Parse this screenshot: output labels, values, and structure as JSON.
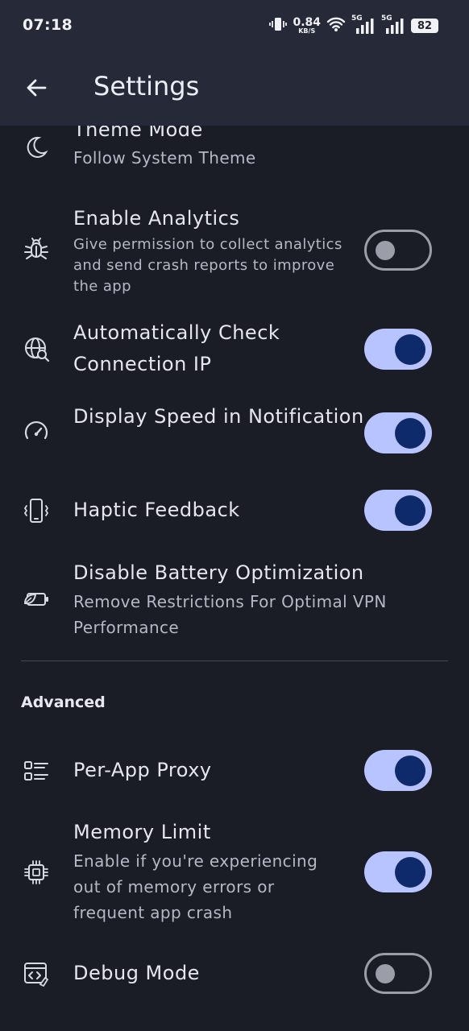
{
  "status_bar": {
    "time": "07:18",
    "net_speed_value": "0.84",
    "net_speed_unit": "KB/S",
    "net_type_1": "5G",
    "net_type_2": "5G",
    "battery": "82"
  },
  "app_bar": {
    "title": "Settings",
    "back_icon": "arrow-left-icon"
  },
  "rows": {
    "theme": {
      "title": "Theme Mode",
      "subtitle": "Follow System Theme",
      "icon": "moon-icon"
    },
    "analytics": {
      "title": "Enable Analytics",
      "subtitle": "Give permission to collect analytics and send crash reports to improve the app",
      "icon": "bug-icon",
      "enabled": false
    },
    "check_ip": {
      "title": "Automatically Check Connection IP",
      "icon": "globe-search-icon",
      "enabled": true
    },
    "speed": {
      "title": "Display Speed in Notification",
      "icon": "speedometer-icon",
      "enabled": true
    },
    "haptic": {
      "title": "Haptic Feedback",
      "icon": "phone-vibrate-icon",
      "enabled": true
    },
    "battery": {
      "title": "Disable Battery Optimization",
      "subtitle": "Remove Restrictions For Optimal VPN Performance",
      "icon": "battery-leaf-icon"
    }
  },
  "advanced": {
    "header": "Advanced",
    "per_app": {
      "title": "Per-App Proxy",
      "icon": "list-icon",
      "enabled": true
    },
    "memory": {
      "title": "Memory Limit",
      "subtitle": "Enable if you're experiencing out of memory errors or frequent app crash",
      "icon": "chip-icon",
      "enabled": true
    },
    "debug": {
      "title": "Debug Mode",
      "icon": "code-window-icon",
      "enabled": false
    }
  },
  "colors": {
    "background": "#1a1c26",
    "app_bar": "#262a38",
    "toggle_on_track": "#b8c4ff",
    "toggle_on_knob": "#0f2a6b",
    "toggle_off": "#9b9ea9"
  }
}
